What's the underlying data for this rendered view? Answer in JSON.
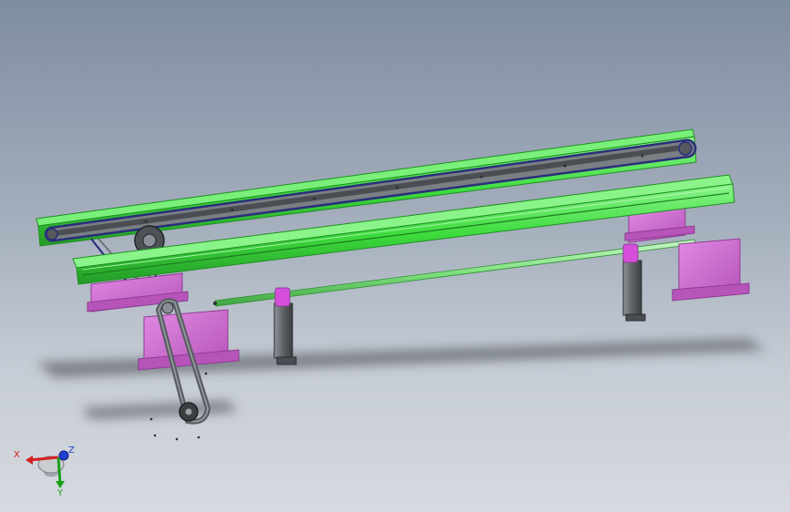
{
  "colors": {
    "background_top": "#7f8da1",
    "background_bottom": "#d6dae0",
    "rail_green": "#3edc3e",
    "rail_green_dark": "#1f8f22",
    "rail_green_light": "#7af07a",
    "bracket_magenta": "#d36ad6",
    "bracket_magenta_dark": "#8e3c93",
    "belt_gray": "#6a6f74",
    "belt_navy": "#2a2f7a",
    "shaft_green": "#8fe88f",
    "support_gray": "#5d6165",
    "axis_x": "#d42020",
    "axis_y": "#19a019",
    "axis_z": "#2040d0"
  },
  "triad": {
    "x_label": "X",
    "y_label": "Y",
    "z_label": "Z"
  },
  "icons": [
    "view-triad-icon"
  ]
}
